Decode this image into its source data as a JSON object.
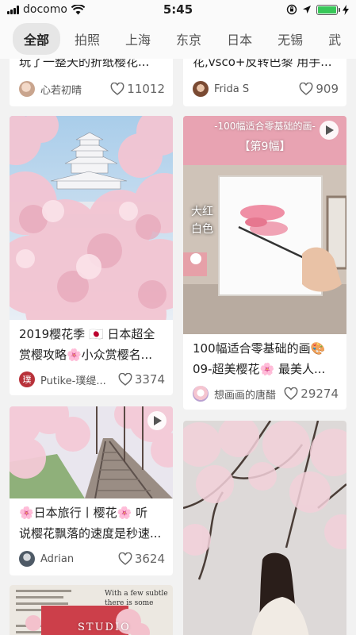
{
  "status_bar": {
    "carrier": "docomo",
    "time": "5:45",
    "battery_color": "#38c759"
  },
  "tabs": [
    {
      "label": "全部",
      "active": true
    },
    {
      "label": "拍照"
    },
    {
      "label": "上海"
    },
    {
      "label": "东京"
    },
    {
      "label": "日本"
    },
    {
      "label": "无锡"
    },
    {
      "label": "武"
    }
  ],
  "cards": {
    "c1": {
      "title": "玩了一整天的折纸樱花...",
      "user": "心若初晴",
      "likes": "11012",
      "avatar": ""
    },
    "c2": {
      "title": "花,vsco+反转巴黎 用手...",
      "user": "Frida S",
      "likes": "909",
      "avatar": ""
    },
    "c3": {
      "title_line1": "2019樱花季 🇯🇵 日本超全",
      "title_line2": "赏樱攻略🌸小众赏樱名...",
      "user": "Putike-璞缇...",
      "likes": "3374",
      "avatar": "璞"
    },
    "c4": {
      "title_line1": "100幅适合零基础的画🎨",
      "title_line2": "09-超美樱花🌸 最美人...",
      "user": "想画画的唐醋",
      "likes": "29274",
      "avatar": "",
      "image_header": "-100幅适合零基础的画-",
      "image_sub": "【第9幅】",
      "image_side_1": "大红",
      "image_side_2": "白色"
    },
    "c5": {
      "title_line1": "🌸日本旅行丨樱花🌸 听",
      "title_line2": "说樱花飘落的速度是秒速...",
      "user": "Adrian",
      "likes": "3624",
      "avatar": ""
    },
    "c6": {
      "image_text_1": "With a few subtle",
      "image_text_2": "there is some",
      "image_text_3": "STUDIO"
    }
  },
  "colors": {
    "sakura": "#f2c4d0",
    "like_icon": "#666666",
    "active_tab_bg": "#e6e6e6"
  }
}
